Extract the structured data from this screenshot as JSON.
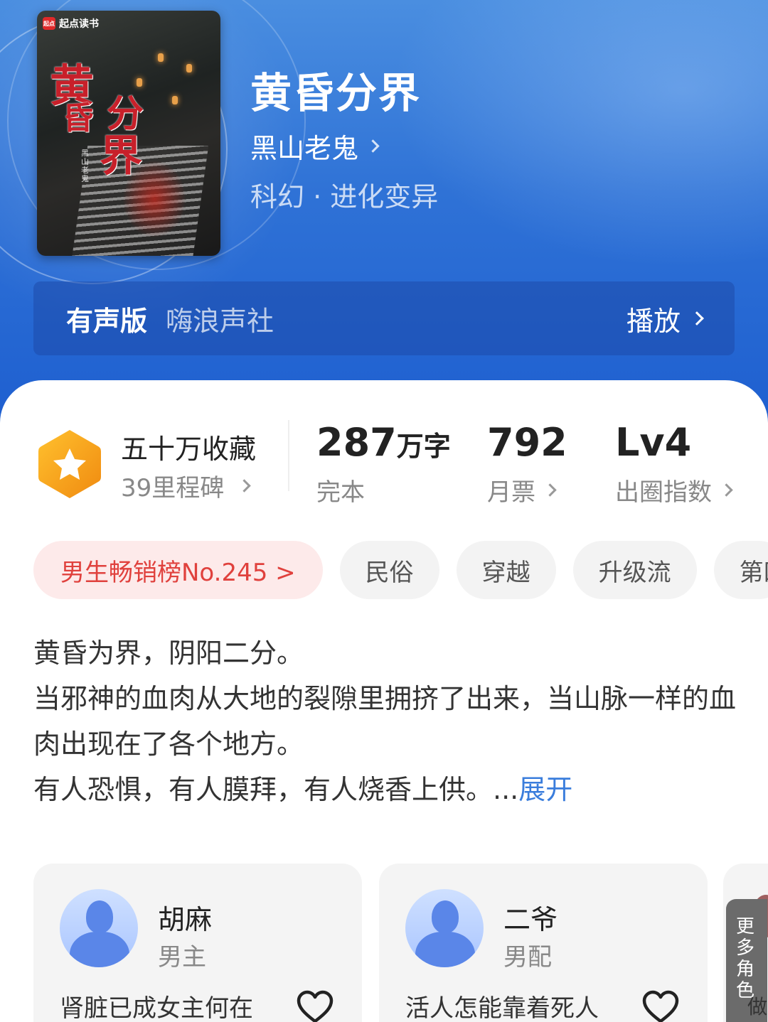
{
  "book": {
    "title": "黄昏分界",
    "author": "黑山老鬼",
    "genre": "科幻 · 进化变异",
    "cover": {
      "brand": "起点读书",
      "brand_mark": "起点",
      "art_title": [
        "黄",
        "昏",
        "分",
        "界"
      ],
      "art_author": "黑山老鬼"
    }
  },
  "audio": {
    "label": "有声版",
    "publisher": "嗨浪声社",
    "play_label": "播放"
  },
  "stats": {
    "collection_title": "五十万收藏",
    "collection_sub": "39里程碑",
    "words_value": "287",
    "words_unit": "万字",
    "words_sub": "完本",
    "tickets_value": "792",
    "tickets_sub": "月票",
    "level_value": "Lv4",
    "level_sub": "出圈指数"
  },
  "tags": {
    "rank": "男生畅销榜No.245 >",
    "items": [
      "民俗",
      "穿越",
      "升级流",
      "第四"
    ]
  },
  "intro": {
    "lines": [
      "黄昏为界，阴阳二分。",
      "当邪神的血肉从大地的裂隙里拥挤了出来，当山脉一样的血肉出现在了各个地方。",
      "有人恐惧，有人膜拜，有人烧香上供。..."
    ],
    "expand_label": "展开"
  },
  "roles": [
    {
      "name": "胡麻",
      "type": "男主",
      "quote": "肾脏已成女主何在"
    },
    {
      "name": "二爷",
      "type": "男配",
      "quote": "活人怎能靠着死人"
    }
  ],
  "more_roles": {
    "label": "更多角色",
    "peek_text": "做"
  },
  "colors": {
    "header_blue": "#2f72d6",
    "rank_tag_text": "#e0413d",
    "rank_tag_bg": "#fdeaea",
    "badge_orange": "#f7a21b",
    "expand_link": "#3a7ddc"
  }
}
